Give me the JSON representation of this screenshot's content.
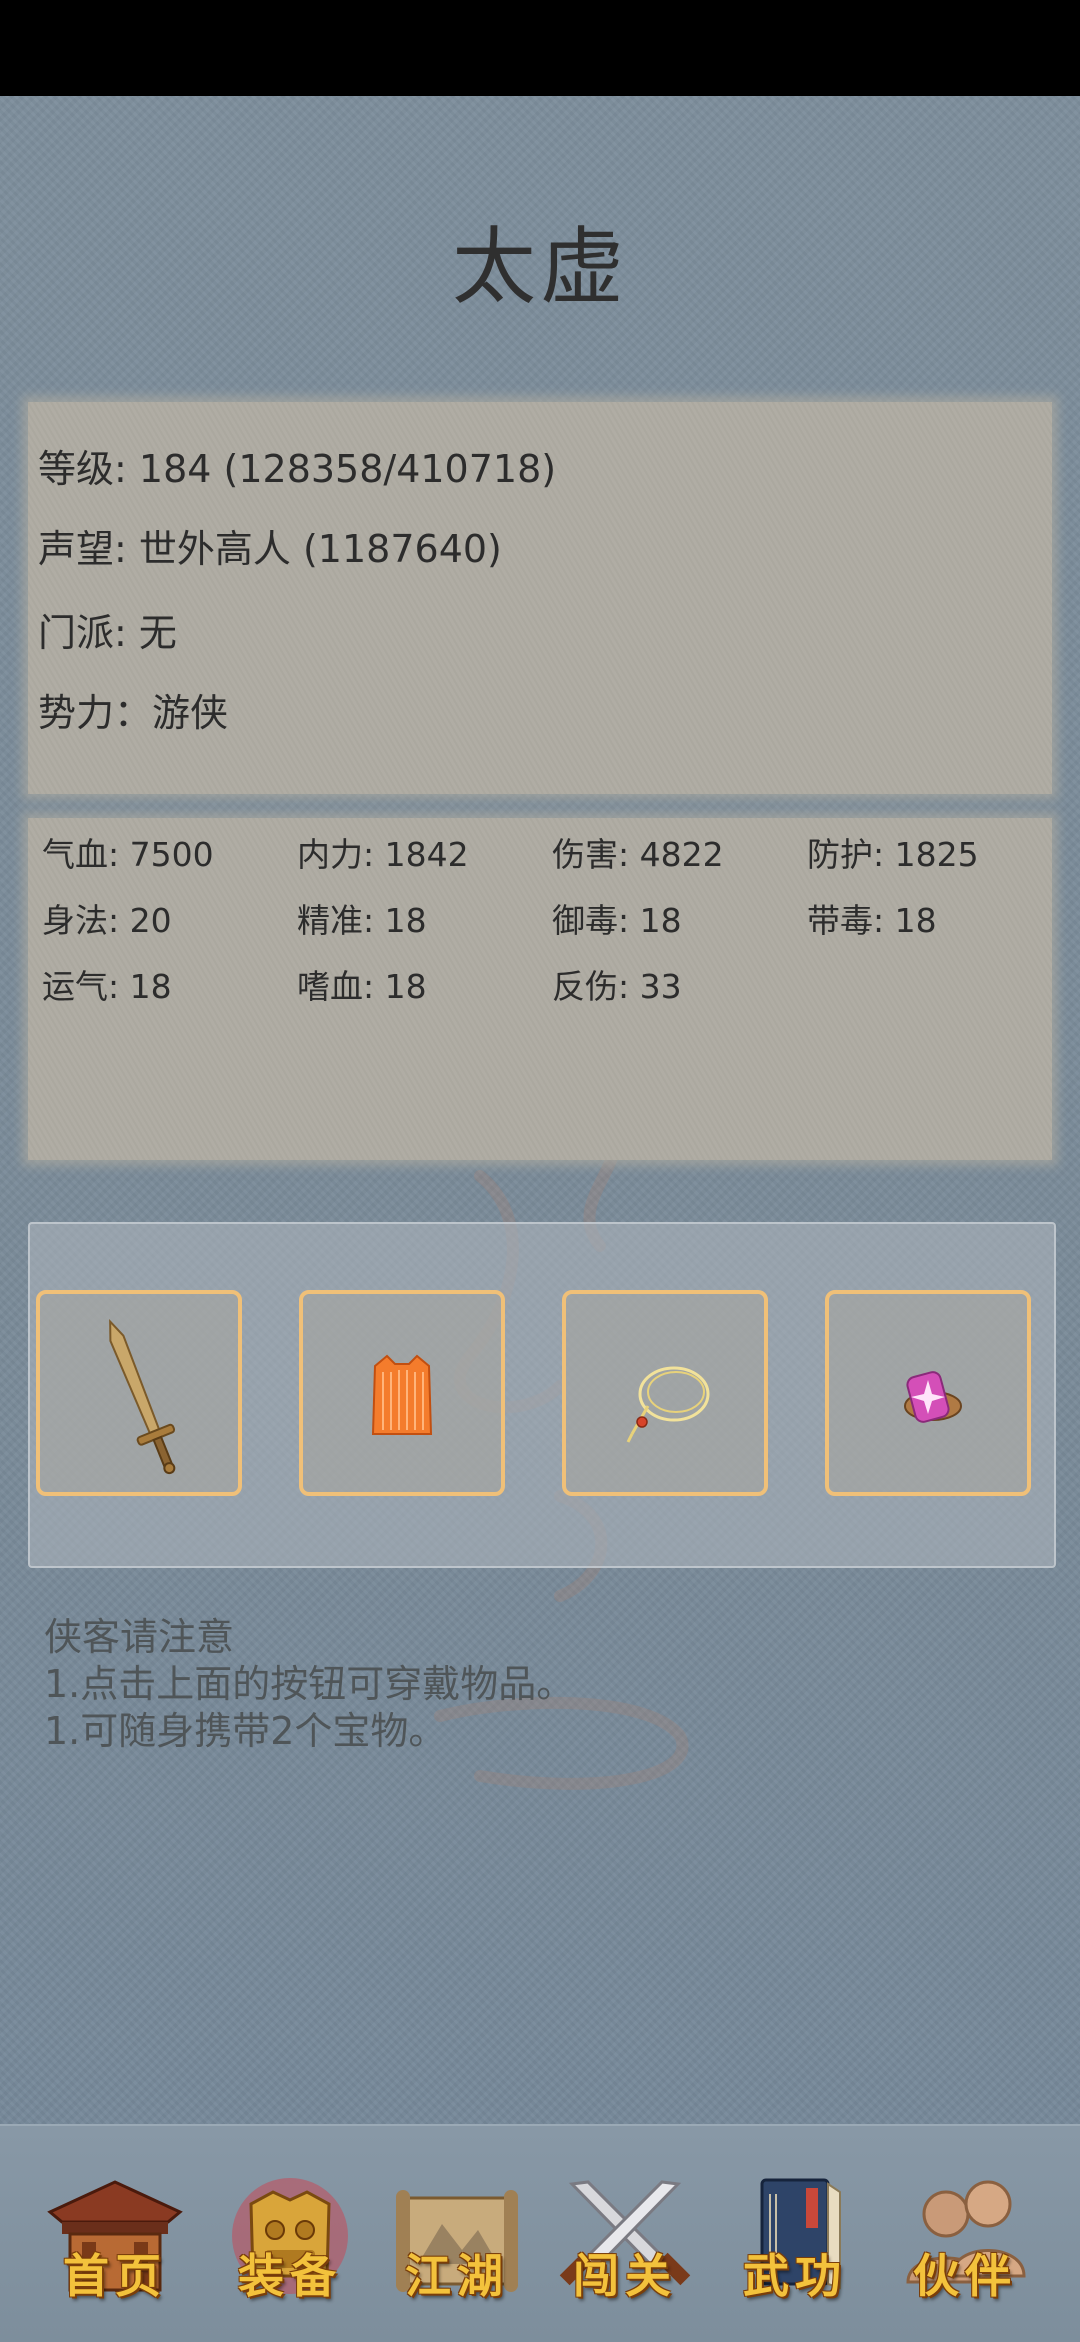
{
  "page_title": "太虚",
  "info": [
    {
      "label": "等级",
      "sep": ": ",
      "value": "184 (128358/410718)"
    },
    {
      "label": "声望",
      "sep": ": ",
      "value": "世外高人 (1187640)"
    },
    {
      "label": "门派",
      "sep": ": ",
      "value": "无"
    },
    {
      "label": "势力",
      "sep": "：",
      "value": "游侠"
    }
  ],
  "stats": [
    {
      "label": "气血",
      "value": "7500"
    },
    {
      "label": "内力",
      "value": "1842"
    },
    {
      "label": "伤害",
      "value": "4822"
    },
    {
      "label": "防护",
      "value": "1825"
    },
    {
      "label": "身法",
      "value": "20"
    },
    {
      "label": "精准",
      "value": "18"
    },
    {
      "label": "御毒",
      "value": "18"
    },
    {
      "label": "带毒",
      "value": "18"
    },
    {
      "label": "运气",
      "value": "18"
    },
    {
      "label": "嗜血",
      "value": "18"
    },
    {
      "label": "反伤",
      "value": "33"
    }
  ],
  "equipment": [
    {
      "icon": "sword-icon"
    },
    {
      "icon": "armor-robe-icon"
    },
    {
      "icon": "necklace-icon"
    },
    {
      "icon": "gem-treasure-icon"
    }
  ],
  "notice": {
    "title": "侠客请注意",
    "lines": [
      "1.点击上面的按钮可穿戴物品。",
      "1.可随身携带2个宝物。"
    ]
  },
  "nav": [
    {
      "label": "首页",
      "icon": "home-pavilion-icon"
    },
    {
      "label": "装备",
      "icon": "armor-icon"
    },
    {
      "label": "江湖",
      "icon": "scroll-map-icon"
    },
    {
      "label": "闯关",
      "icon": "crossed-swords-icon"
    },
    {
      "label": "武功",
      "icon": "martial-book-icon"
    },
    {
      "label": "伙伴",
      "icon": "companions-icon"
    }
  ],
  "colors": {
    "background": "#7a8b99",
    "panel": "#aeaba2",
    "slot_border": "#f0c078",
    "nav_label": "#f3c23c"
  }
}
